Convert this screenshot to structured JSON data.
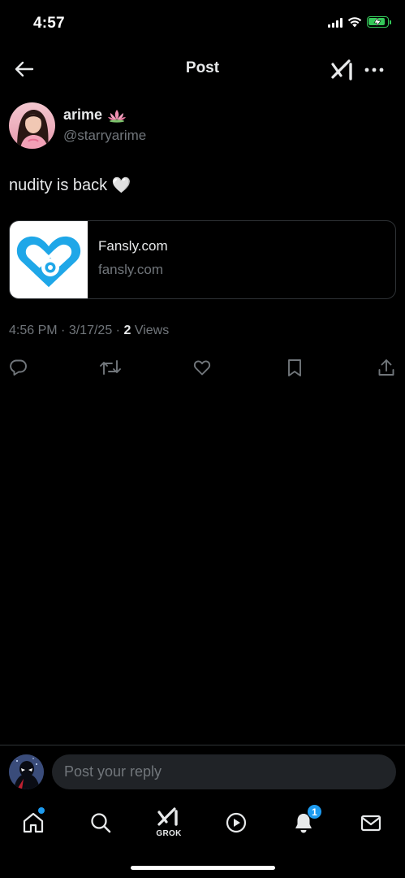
{
  "status_bar": {
    "time": "4:57"
  },
  "header": {
    "title": "Post"
  },
  "post": {
    "author_name": "arime",
    "author_handle": "@starryarime",
    "text": "nudity is back",
    "text_emoji": "🤍",
    "link_card": {
      "title": "Fansly.com",
      "domain": "fansly.com"
    },
    "time": "4:56 PM",
    "date": "3/17/25",
    "views_count": "2",
    "views_label": "Views"
  },
  "reply": {
    "placeholder": "Post your reply"
  },
  "bottom_nav": {
    "grok_label": "GROK",
    "notifications_badge": "1"
  },
  "colors": {
    "background": "#000000",
    "text_primary": "#e7e9ea",
    "text_secondary": "#71767b",
    "accent": "#1d9bf0",
    "battery": "#34c759",
    "brand_fansly": "#1fa7e8"
  },
  "icons": [
    "back-arrow-icon",
    "grok-icon",
    "more-icon",
    "lotus-icon",
    "fansly-logo-icon",
    "reply-icon",
    "repost-icon",
    "like-icon",
    "bookmark-icon",
    "share-icon",
    "home-icon",
    "search-icon",
    "video-icon",
    "bell-icon",
    "mail-icon"
  ]
}
